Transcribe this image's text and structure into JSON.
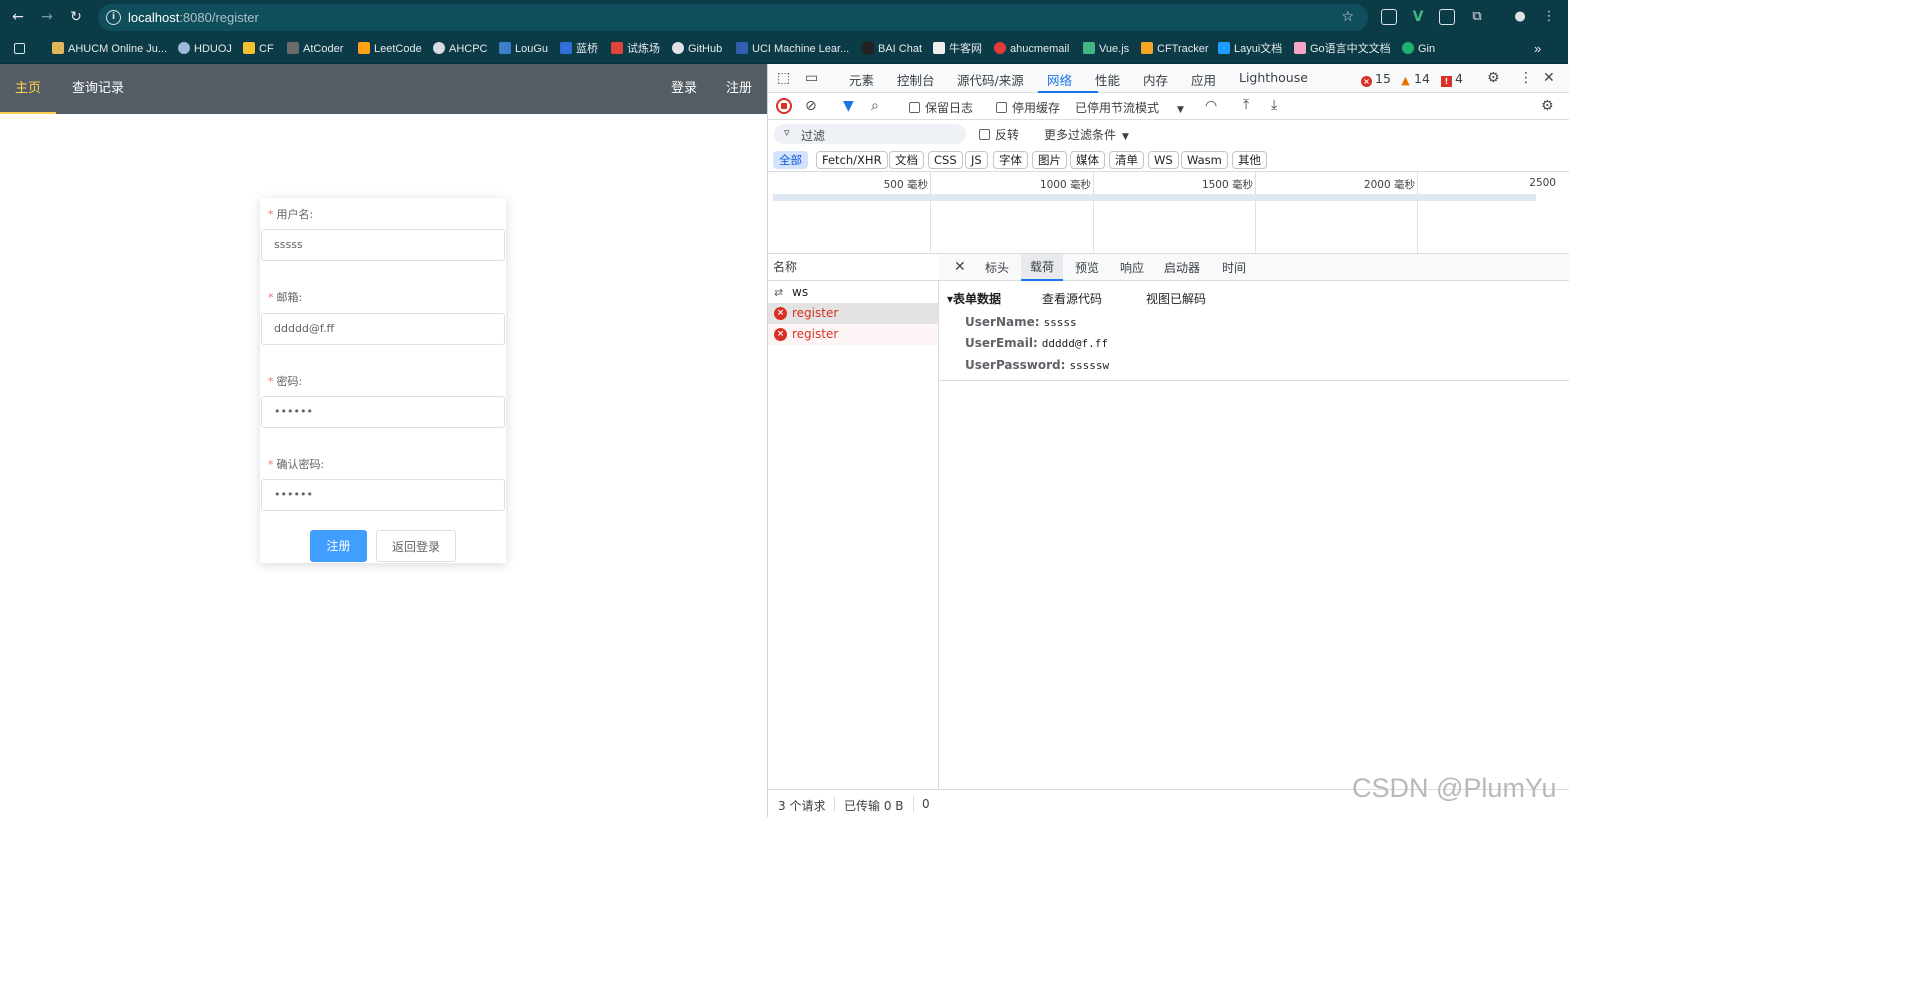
{
  "browser": {
    "url_host": "localhost",
    "url_path": ":8080/register",
    "bookmarks": [
      "AHUCM Online Ju...",
      "HDUOJ",
      "CF",
      "AtCoder",
      "LeetCode",
      "AHCPC",
      "LouGu",
      "蓝桥",
      "试炼场",
      "GitHub",
      "UCI Machine Lear...",
      "BAI Chat",
      "牛客网",
      "ahucmemail",
      "Vue.js",
      "CFTracker",
      "Layui文档",
      "Go语言中文文档",
      "Gin"
    ],
    "more_bookmarks": "»"
  },
  "app": {
    "nav": {
      "home": "主页",
      "history": "查询记录",
      "login": "登录",
      "register": "注册"
    },
    "form": {
      "username_label": "用户名:",
      "username_value": "sssss",
      "email_label": "邮箱:",
      "email_value": "ddddd@f.ff",
      "password_label": "密码:",
      "password_value": "••••••",
      "confirm_label": "确认密码:",
      "confirm_value": "••••••",
      "required_mark": "*",
      "submit_label": "注册",
      "back_label": "返回登录"
    }
  },
  "devtools": {
    "tabs": [
      "元素",
      "控制台",
      "源代码/来源",
      "网络",
      "性能",
      "内存",
      "应用",
      "Lighthouse"
    ],
    "errors": "15",
    "warnings": "14",
    "issues": "4",
    "toolbar": {
      "preserve_log": "保留日志",
      "disable_cache": "停用缓存",
      "throttle": "已停用节流模式"
    },
    "filter": {
      "placeholder": "过滤",
      "invert": "反转",
      "more_filters": "更多过滤条件"
    },
    "types": [
      "全部",
      "Fetch/XHR",
      "文档",
      "CSS",
      "JS",
      "字体",
      "图片",
      "媒体",
      "清单",
      "WS",
      "Wasm",
      "其他"
    ],
    "timeline_ticks": [
      "500 毫秒",
      "1000 毫秒",
      "1500 毫秒",
      "2000 毫秒",
      "2500"
    ],
    "request_list": {
      "header": "名称",
      "rows": [
        {
          "name": "ws",
          "status": "ws"
        },
        {
          "name": "register",
          "status": "error"
        },
        {
          "name": "register",
          "status": "error"
        }
      ]
    },
    "detail": {
      "tabs": [
        "标头",
        "载荷",
        "预览",
        "响应",
        "启动器",
        "时间"
      ],
      "section_title": "▾表单数据",
      "view_source": "查看源代码",
      "view_decoded": "视图已解码",
      "fields": [
        {
          "key": "UserName:",
          "value": "sssss"
        },
        {
          "key": "UserEmail:",
          "value": "ddddd@f.ff"
        },
        {
          "key": "UserPassword:",
          "value": "sssssw"
        }
      ]
    },
    "status": {
      "requests": "3 个请求",
      "transferred": "已传输 0 B",
      "extra": "0"
    }
  },
  "watermark": "CSDN @PlumYu"
}
